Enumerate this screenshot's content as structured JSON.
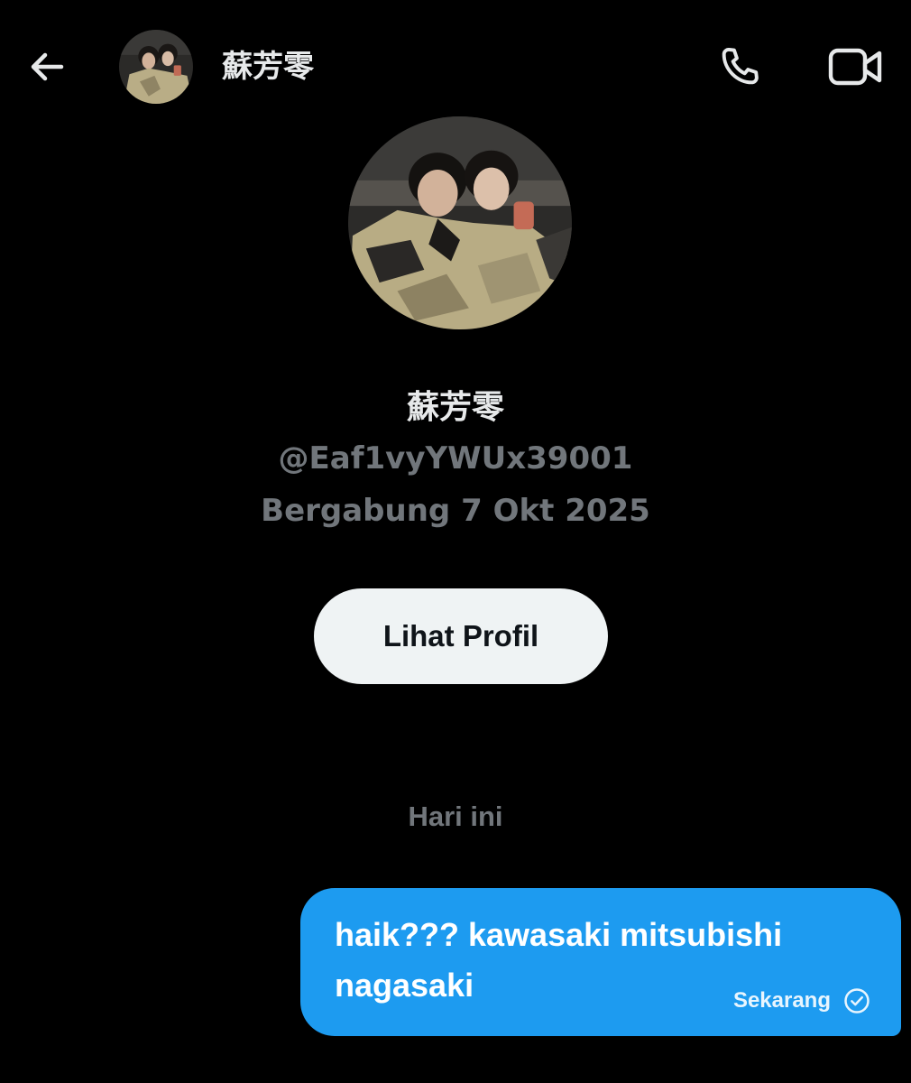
{
  "header": {
    "back_icon": "arrow-left-icon",
    "name": "蘇芳零",
    "call_icon": "phone-icon",
    "video_icon": "video-camera-icon"
  },
  "profile": {
    "name": "蘇芳零",
    "handle": "@Eaf1vyYWUx39001",
    "joined": "Bergabung 7 Okt 2025",
    "view_profile_label": "Lihat Profil"
  },
  "conversation": {
    "date_label": "Hari ini",
    "messages": [
      {
        "text": "haik??? kawasaki mitsubishi nagasaki",
        "time": "Sekarang",
        "status_icon": "check-circle-icon"
      }
    ]
  },
  "colors": {
    "background": "#000000",
    "primary_text": "#e7e9ea",
    "secondary_text": "#71767b",
    "accent": "#1d9bf0",
    "button_bg": "#eff3f4"
  }
}
